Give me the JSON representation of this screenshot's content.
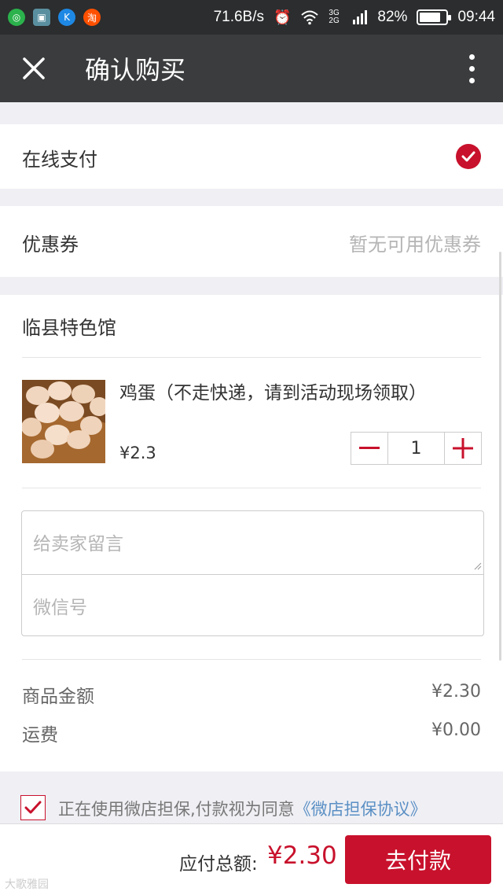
{
  "status_bar": {
    "apps": [
      {
        "icon": "wechat-app-icon",
        "color": "#2bb24c",
        "glyph": "◎"
      },
      {
        "icon": "gallery-app-icon",
        "color": "#5a8fa0",
        "glyph": "▣"
      },
      {
        "icon": "k-app-icon",
        "color": "#1e88e5",
        "glyph": "K"
      },
      {
        "icon": "taobao-app-icon",
        "color": "#ff5000",
        "glyph": "淘"
      }
    ],
    "net_speed": "71.6B/s",
    "signal_label": "3G 2G",
    "battery": "82%",
    "battery_level": 0.82,
    "time": "09:44"
  },
  "nav": {
    "title": "确认购买"
  },
  "payment": {
    "label": "在线支付",
    "selected": true
  },
  "coupon": {
    "label": "优惠券",
    "value": "暂无可用优惠券"
  },
  "shop": {
    "name": "临县特色馆"
  },
  "product": {
    "name": "鸡蛋（不走快递，请到活动现场领取）",
    "price": "¥2.3",
    "quantity": "1"
  },
  "message": {
    "note_placeholder": "给卖家留言",
    "wechat_placeholder": "微信号"
  },
  "summary": {
    "goods_label": "商品金额",
    "goods_value": "¥2.30",
    "shipping_label": "运费",
    "shipping_value": "¥0.00"
  },
  "agreement": {
    "text": "正在使用微店担保,付款视为同意",
    "link": "《微店担保协议》",
    "checked": true
  },
  "footer": {
    "total_label": "应付总额:",
    "total_value": "¥2.30",
    "pay_button": "去付款",
    "watermark": "大歌雅园"
  },
  "colors": {
    "accent": "#c8112c",
    "link": "#5a8fc4",
    "nav_bg": "#3a3c3d",
    "status_bg": "#2b2d2e"
  }
}
